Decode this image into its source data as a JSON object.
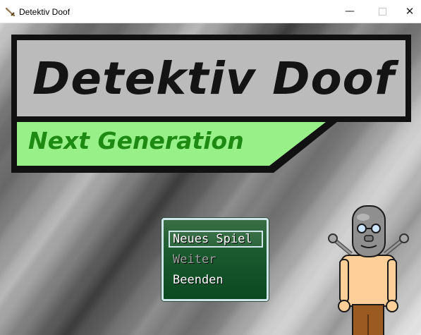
{
  "window": {
    "title": "Detektiv Doof",
    "icon": "sword-icon",
    "controls": [
      "minimize",
      "maximize",
      "close"
    ]
  },
  "game": {
    "logo_title": "Detektiv Doof",
    "logo_subtitle": "Next Generation",
    "colors": {
      "logo_frame": "#111111",
      "logo_panel": "#bbbbbb",
      "subtitle_panel": "#98f088",
      "subtitle_text": "#1e8a14",
      "menu_bg": "#1b5a2e",
      "menu_border": "#cfe6ea"
    },
    "menu": {
      "items": [
        {
          "label": "Neues Spiel",
          "selected": true,
          "enabled": true
        },
        {
          "label": "Weiter",
          "selected": false,
          "enabled": false
        },
        {
          "label": "Beenden",
          "selected": false,
          "enabled": true
        }
      ]
    },
    "character": "bald-man-with-antennae"
  }
}
